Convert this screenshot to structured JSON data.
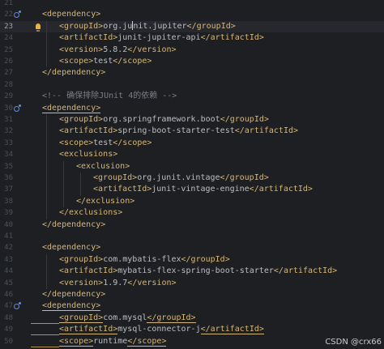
{
  "editor": {
    "lines": [
      {
        "n": "21",
        "indent": 0,
        "text": ""
      },
      {
        "n": "22",
        "indent": 1,
        "text": "<dependency>",
        "icon": true
      },
      {
        "n": "23",
        "indent": 2,
        "text": "<groupId>org.junit.jupiter</groupId>",
        "current": true,
        "bulb": true
      },
      {
        "n": "24",
        "indent": 2,
        "text": "<artifactId>junit-jupiter-api</artifactId>"
      },
      {
        "n": "25",
        "indent": 2,
        "text": "<version>5.8.2</version>"
      },
      {
        "n": "26",
        "indent": 2,
        "text": "<scope>test</scope>"
      },
      {
        "n": "27",
        "indent": 1,
        "text": "</dependency>"
      },
      {
        "n": "28",
        "indent": 0,
        "text": ""
      },
      {
        "n": "29",
        "indent": 1,
        "text": "<!-- 确保排除JUnit 4的依赖 -->",
        "comment": true
      },
      {
        "n": "30",
        "indent": 1,
        "text": "<dependency>",
        "icon": true,
        "underline": true
      },
      {
        "n": "31",
        "indent": 2,
        "text": "<groupId>org.springframework.boot</groupId>"
      },
      {
        "n": "32",
        "indent": 2,
        "text": "<artifactId>spring-boot-starter-test</artifactId>"
      },
      {
        "n": "33",
        "indent": 2,
        "text": "<scope>test</scope>"
      },
      {
        "n": "34",
        "indent": 2,
        "text": "<exclusions>"
      },
      {
        "n": "35",
        "indent": 3,
        "text": "<exclusion>"
      },
      {
        "n": "36",
        "indent": 4,
        "text": "<groupId>org.junit.vintage</groupId>"
      },
      {
        "n": "37",
        "indent": 4,
        "text": "<artifactId>junit-vintage-engine</artifactId>"
      },
      {
        "n": "38",
        "indent": 3,
        "text": "</exclusion>"
      },
      {
        "n": "39",
        "indent": 2,
        "text": "</exclusions>"
      },
      {
        "n": "40",
        "indent": 1,
        "text": "</dependency>"
      },
      {
        "n": "41",
        "indent": 0,
        "text": ""
      },
      {
        "n": "42",
        "indent": 1,
        "text": "<dependency>"
      },
      {
        "n": "43",
        "indent": 2,
        "text": "<groupId>com.mybatis-flex</groupId>"
      },
      {
        "n": "44",
        "indent": 2,
        "text": "<artifactId>mybatis-flex-spring-boot-starter</artifactId>"
      },
      {
        "n": "45",
        "indent": 2,
        "text": "<version>1.9.7</version>"
      },
      {
        "n": "46",
        "indent": 1,
        "text": "</dependency>"
      },
      {
        "n": "47",
        "indent": 1,
        "text": "<dependency>",
        "icon": true,
        "underline": true
      },
      {
        "n": "48",
        "indent": 2,
        "text": "<groupId>com.mysql</groupId>",
        "underline": true,
        "squiggle": true
      },
      {
        "n": "49",
        "indent": 2,
        "text": "<artifactId>mysql-connector-j</artifactId>",
        "underline": true,
        "squiggle": true
      },
      {
        "n": "50",
        "indent": 2,
        "text": "<scope>runtime</scope>",
        "underline": true,
        "squiggle": true
      }
    ]
  },
  "watermark": "CSDN @crx66",
  "colors": {
    "background": "#1e1f22",
    "current_line": "#26282e",
    "tag": "#d5b778",
    "text": "#bcbec4",
    "comment": "#7a7e85",
    "line_number": "#4b5059",
    "gutter_icon": "#5f8ce8",
    "bulb": "#e8b63a"
  }
}
